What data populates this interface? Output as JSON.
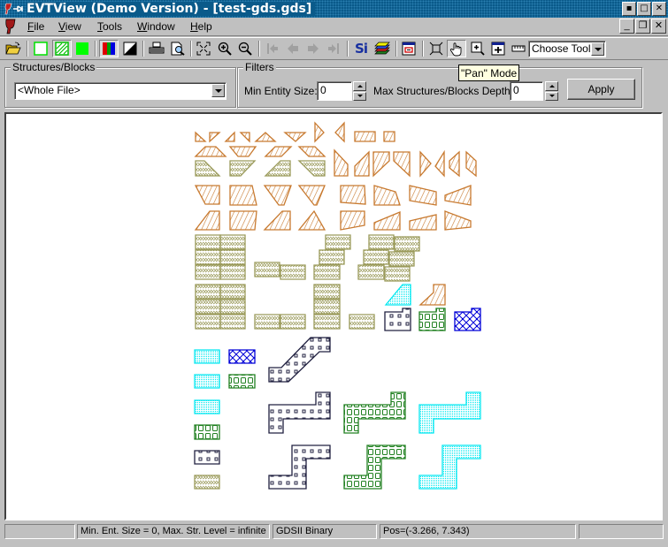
{
  "window": {
    "title": "EVTView (Demo Version) - [test-gds.gds]",
    "controls": [
      "minimize",
      "maximize",
      "close"
    ]
  },
  "menubar": {
    "items": [
      {
        "label": "File",
        "accel": "F"
      },
      {
        "label": "View",
        "accel": "V"
      },
      {
        "label": "Tools",
        "accel": "T"
      },
      {
        "label": "Window",
        "accel": "W"
      },
      {
        "label": "Help",
        "accel": "H"
      }
    ],
    "mdi_controls": [
      "minimize",
      "restore",
      "close"
    ]
  },
  "toolbar": {
    "buttons": [
      {
        "name": "open-file",
        "icon": "folder-open-icon"
      },
      {
        "name": "outline-mode",
        "icon": "outline-square-icon"
      },
      {
        "name": "hatch-mode",
        "icon": "hatched-square-icon",
        "pressed": true
      },
      {
        "name": "fill-mode",
        "icon": "filled-square-icon"
      },
      {
        "name": "layer-colors",
        "icon": "rgb-bars-icon",
        "pressed": true
      },
      {
        "name": "invert-colors",
        "icon": "black-white-icon"
      },
      {
        "name": "print",
        "icon": "printer-icon"
      },
      {
        "name": "print-preview",
        "icon": "print-preview-icon"
      },
      {
        "name": "zoom-fit",
        "icon": "zoom-fit-icon"
      },
      {
        "name": "zoom-in",
        "icon": "zoom-in-icon"
      },
      {
        "name": "zoom-out",
        "icon": "zoom-out-icon"
      },
      {
        "name": "first-view",
        "icon": "first-arrow-icon",
        "disabled": true
      },
      {
        "name": "previous-view",
        "icon": "left-arrow-icon",
        "disabled": true
      },
      {
        "name": "next-view",
        "icon": "right-arrow-icon",
        "disabled": true
      },
      {
        "name": "last-view",
        "icon": "last-arrow-icon",
        "disabled": true
      },
      {
        "name": "si-info",
        "icon": "si-logo-icon",
        "label": "Si"
      },
      {
        "name": "layers",
        "icon": "layers-stack-icon"
      },
      {
        "name": "window-toggle",
        "icon": "window-red-icon"
      },
      {
        "name": "select-mode",
        "icon": "select-frame-icon"
      },
      {
        "name": "pan-mode",
        "icon": "hand-icon",
        "pressed": true
      },
      {
        "name": "zoom-window",
        "icon": "zoom-window-icon"
      },
      {
        "name": "zoom-area",
        "icon": "zoom-area-icon"
      },
      {
        "name": "measure",
        "icon": "ruler-icon"
      }
    ],
    "tool_select": {
      "value": "Choose Tool"
    }
  },
  "tooltip": {
    "text": "\"Pan\" Mode"
  },
  "structures": {
    "group_label": "Structures/Blocks",
    "selected": "<Whole File>"
  },
  "filters": {
    "group_label": "Filters",
    "min_entity_label": "Min Entity Size:",
    "min_entity_value": "0",
    "max_depth_label": "Max Structures/Blocks Depth:",
    "max_depth_value": "0",
    "apply_label": "Apply"
  },
  "layers": {
    "orange": "#c87a30",
    "olive": "#9a9a5a",
    "cyan": "#00e8f0",
    "navy": "#202040",
    "green": "#208020",
    "blue": "#0000d8"
  },
  "statusbar": {
    "cells": [
      "",
      "Min. Ent. Size = 0,  Max. Str. Level = infinite",
      "GDSII Binary",
      "Pos=(-3.266, 7.343)",
      ""
    ]
  }
}
